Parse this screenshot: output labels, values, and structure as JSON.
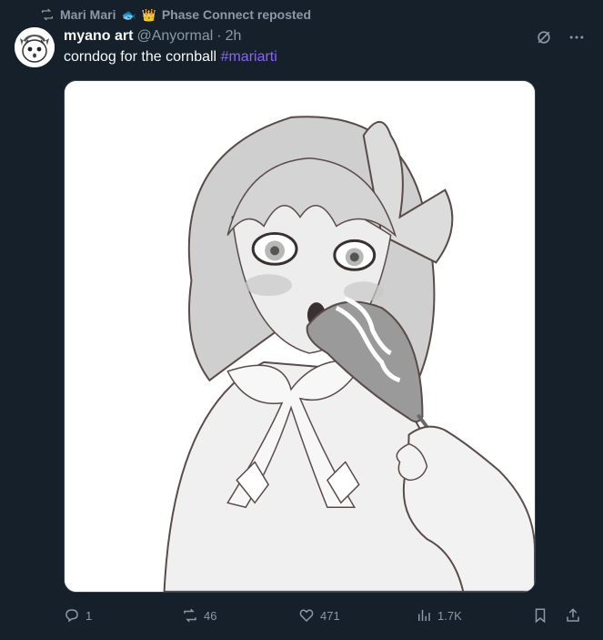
{
  "repost_banner": {
    "user": "Mari Mari",
    "emojis": [
      "🐟",
      "👑"
    ],
    "suffix": "Phase Connect reposted"
  },
  "tweet": {
    "display_name": "myano art",
    "handle": "@Anyormal",
    "separator": "·",
    "time": "2h",
    "text": "corndog for the cornball",
    "hashtag": "#mariarti"
  },
  "actions": {
    "replies": "1",
    "reposts": "46",
    "likes": "471",
    "views": "1.7K"
  },
  "icons": {
    "repost_banner": "repost-icon",
    "grok": "grok-icon",
    "more": "more-icon",
    "reply": "reply-icon",
    "repost": "repost-icon",
    "like": "heart-icon",
    "views": "views-icon",
    "bookmark": "bookmark-icon",
    "share": "share-icon"
  },
  "colors": {
    "background": "#15202b",
    "text": "#f7f9f9",
    "muted": "#8b98a5",
    "hashtag": "#8a63f8"
  }
}
